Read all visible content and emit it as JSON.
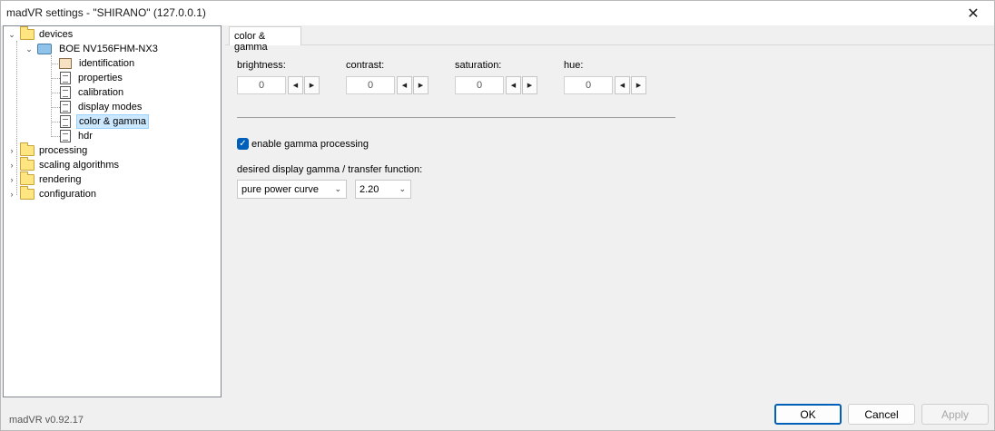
{
  "window": {
    "title": "madVR settings - \"SHIRANO\" (127.0.0.1)",
    "close_glyph": "✕"
  },
  "tree": {
    "devices": "devices",
    "device_name": "BOE NV156FHM-NX3",
    "identification": "identification",
    "properties": "properties",
    "calibration": "calibration",
    "display_modes": "display modes",
    "color_gamma": "color & gamma",
    "hdr": "hdr",
    "processing": "processing",
    "scaling_algorithms": "scaling algorithms",
    "rendering": "rendering",
    "configuration": "configuration"
  },
  "tab": {
    "label": "color & gamma"
  },
  "controls": {
    "brightness": {
      "label": "brightness:",
      "value": "0"
    },
    "contrast": {
      "label": "contrast:",
      "value": "0"
    },
    "saturation": {
      "label": "saturation:",
      "value": "0"
    },
    "hue": {
      "label": "hue:",
      "value": "0"
    },
    "enable_gamma": {
      "label": "enable gamma processing",
      "checked": true
    },
    "gamma_label": "desired display gamma / transfer function:",
    "gamma_curve": "pure power curve",
    "gamma_value": "2.20"
  },
  "footer": {
    "version": "madVR v0.92.17",
    "ok": "OK",
    "cancel": "Cancel",
    "apply": "Apply"
  },
  "colors": {
    "accent": "#005fb8",
    "selection": "#cce8ff"
  }
}
